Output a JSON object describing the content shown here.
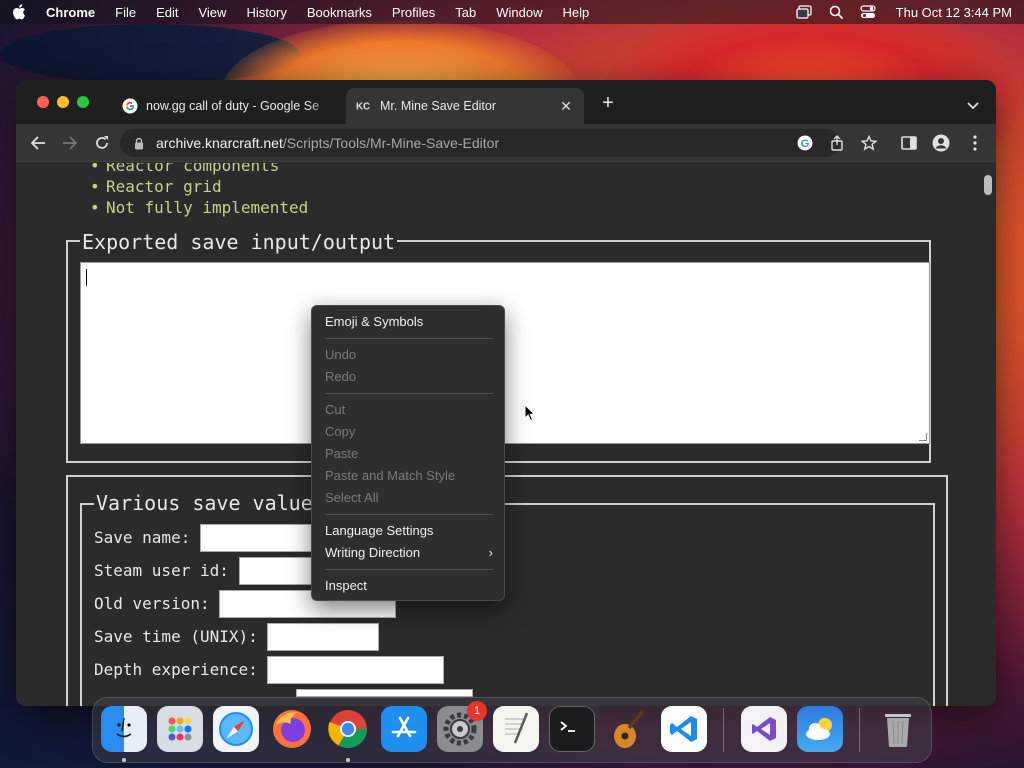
{
  "menubar": {
    "app_name": "Chrome",
    "items": [
      "File",
      "Edit",
      "View",
      "History",
      "Bookmarks",
      "Profiles",
      "Tab",
      "Window",
      "Help"
    ],
    "clock": "Thu Oct 12  3:44 PM"
  },
  "browser": {
    "tabs": [
      {
        "title": "now.gg call of duty - Google Se",
        "favicon": "google-g-icon",
        "active": false
      },
      {
        "title": "Mr. Mine Save Editor",
        "favicon": "kc-logo-icon",
        "active": true
      }
    ],
    "url_host": "archive.knarcraft.net",
    "url_path": "/Scripts/Tools/Mr-Mine-Save-Editor"
  },
  "page": {
    "bullets": [
      "Reactor components",
      "Reactor grid",
      "Not fully implemented"
    ],
    "export_legend": "Exported save input/output",
    "export_value": "",
    "values_legend": "Various save values",
    "fields": [
      {
        "label": "Save name:",
        "value": ""
      },
      {
        "label": "Steam user id:",
        "value": ""
      },
      {
        "label": "Old version:",
        "value": ""
      },
      {
        "label": "Save time (UNIX):",
        "value": ""
      },
      {
        "label": "Depth experience:",
        "value": ""
      }
    ]
  },
  "context_menu": {
    "items": [
      {
        "label": "Emoji & Symbols",
        "enabled": true
      },
      {
        "label": "Undo",
        "enabled": false
      },
      {
        "label": "Redo",
        "enabled": false
      },
      {
        "label": "Cut",
        "enabled": false
      },
      {
        "label": "Copy",
        "enabled": false
      },
      {
        "label": "Paste",
        "enabled": false
      },
      {
        "label": "Paste and Match Style",
        "enabled": false
      },
      {
        "label": "Select All",
        "enabled": false
      },
      {
        "label": "Language Settings",
        "enabled": true
      },
      {
        "label": "Writing Direction",
        "enabled": true,
        "submenu": true
      },
      {
        "label": "Inspect",
        "enabled": true
      }
    ]
  },
  "dock": {
    "apps": [
      "finder-icon",
      "launchpad-icon",
      "safari-icon",
      "firefox-icon",
      "chrome-icon",
      "app-store-icon",
      "system-settings-icon",
      "textedit-icon",
      "terminal-icon",
      "garageband-icon",
      "vscode-icon",
      "visual-studio-icon",
      "weather-icon",
      "trash-icon"
    ],
    "settings_badge": "1"
  },
  "colors": {
    "bullet_text": "#c2d48a",
    "page_bg": "#2b2b2b",
    "menu_bg": "#2e2e30"
  }
}
